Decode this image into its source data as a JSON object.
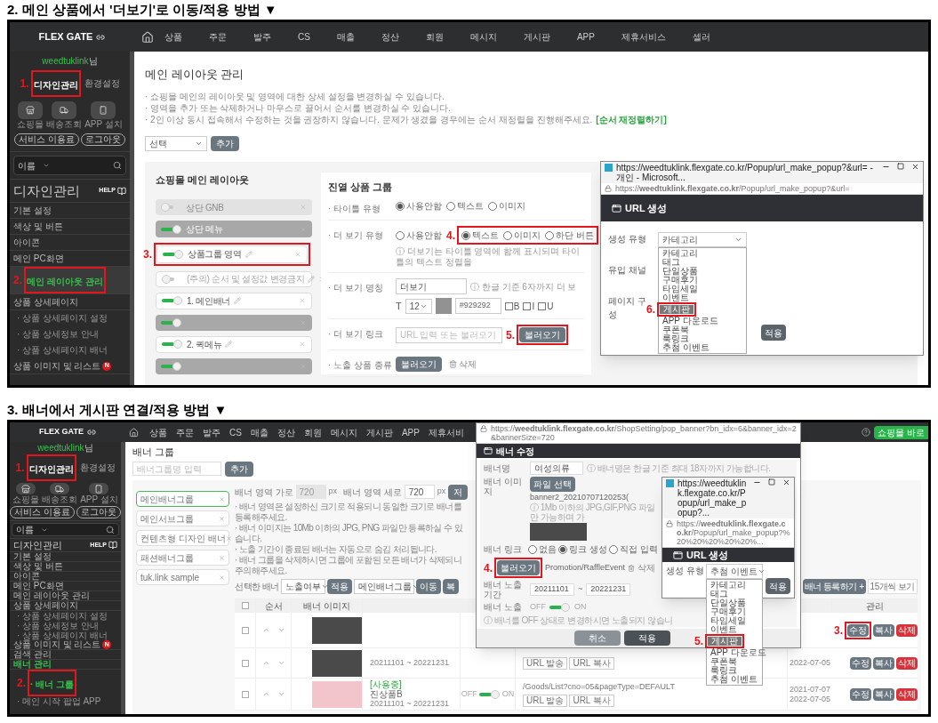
{
  "guide_1": {
    "heading": "2. 메인 상품에서 '더보기'로 이동/적용 방법 ▼",
    "topbar": {
      "logo": "FLEX GATE",
      "menu": [
        "상품",
        "주문",
        "발주",
        "CS",
        "매출",
        "정산",
        "회원",
        "메시지",
        "게시판",
        "APP",
        "제휴서비스",
        "셀러"
      ]
    },
    "sidebar": {
      "user": "weedtuklink",
      "user_suffix": "님",
      "tabs": [
        {
          "label": "디자인관리",
          "selected": true,
          "step": "1."
        },
        {
          "label": "환경설정",
          "selected": false
        }
      ],
      "shortcuts": [
        {
          "label": "쇼핑몰",
          "kind": "store"
        },
        {
          "label": "배송조회",
          "kind": "truck"
        },
        {
          "label": "APP 설치",
          "kind": "phone"
        }
      ],
      "buttons": [
        "서비스 이용료",
        "로그아웃"
      ],
      "search_select": "이름",
      "title": "디자인관리",
      "help": "HELP",
      "items": [
        {
          "label": "기본 설정",
          "kind": "item",
          "selected": false
        },
        {
          "label": "색상 및 버튼",
          "kind": "item",
          "selected": false
        },
        {
          "label": "아이콘",
          "kind": "item",
          "selected": false
        },
        {
          "label": "메인 PC화면",
          "kind": "item",
          "selected": false
        },
        {
          "label": "메인 레이아웃 관리",
          "kind": "item",
          "selected": true,
          "step": "2."
        },
        {
          "label": "상품 상세페이지",
          "kind": "item",
          "selected": false
        },
        {
          "label": "· 상품 상세페이지 설정",
          "kind": "sub",
          "selected": false
        },
        {
          "label": "· 상품 상세정보 안내",
          "kind": "sub",
          "selected": false
        },
        {
          "label": "· 상품 상세페이지 배너",
          "kind": "sub",
          "selected": false
        },
        {
          "label": "상품 이미지 및 리스트",
          "kind": "item",
          "selected": false,
          "badge": "N"
        }
      ]
    },
    "main": {
      "page_title": "메인 레이아웃 관리",
      "notes": [
        "· 쇼핑몰 메인의 레이아웃 및 영역에 대한 상세 설정을 변경하실 수 있습니다.",
        "· 영역을 추가 또는 삭제하거나 마우스로 끌어서 순서를 변경하실 수 있습니다.",
        "· 2인 이상 동시 접속해서 수정하는 것을 권장하지 않습니다. 문제가 생겼을 경우에는 순서 재정렬을 진행해주세요."
      ],
      "reorder_link": "[순서 재정렬하기]",
      "add_select": "선택",
      "add_button": "추가",
      "layout_panel": {
        "title": "쇼핑몰 메인 레이아웃",
        "items": [
          {
            "label": "상단 GNB",
            "kind": "fixed",
            "on": false,
            "editable": false
          },
          {
            "label": "상단 메뉴",
            "kind": "fixed",
            "on": true,
            "editable": false
          },
          {
            "label": "상품그룹 영역",
            "kind": "normal",
            "on": true,
            "editable": true,
            "step": "3."
          },
          {
            "label": "(주의) 순서 및 설정값 변경금지",
            "kind": "normal",
            "on": false,
            "editable": true
          },
          {
            "label": "1. 메인배너",
            "kind": "normal",
            "on": true,
            "editable": true
          },
          {
            "kind": "fixed",
            "on": true,
            "editable": false
          },
          {
            "label": "2. 퀵메뉴",
            "kind": "normal",
            "on": true,
            "editable": true
          },
          {
            "kind": "fixed",
            "on": true,
            "editable": false
          }
        ]
      },
      "settings_panel": {
        "title": "진열 상품 그룹",
        "rows": [
          {
            "label": "· 타이틀 유형",
            "kind": "radio",
            "options": [
              {
                "label": "사용안함",
                "selected": true,
                "highlighted": false
              },
              {
                "label": "텍스트",
                "selected": false,
                "highlighted": false
              },
              {
                "label": "이미지",
                "selected": false,
                "highlighted": false
              }
            ]
          },
          {
            "label": "· 더 보기 유형",
            "kind": "radio",
            "step": "4.",
            "options": [
              {
                "label": "사용안함",
                "selected": false,
                "highlighted": false
              },
              {
                "label": "텍스트",
                "selected": true,
                "highlighted": true
              },
              {
                "label": "이미지",
                "selected": false,
                "highlighted": true
              },
              {
                "label": "하단 버튼",
                "selected": false,
                "highlighted": true
              }
            ],
            "hint": "ⓘ 더보기는 타이틀 영역에 함께 표시되며 타이틀의 텍스트 정렬을"
          },
          {
            "label": "· 더 보기 명칭",
            "kind": "name",
            "value": "더보기",
            "hint": "ⓘ 한글 기준 6자까지 더 보",
            "style": {
              "prefix": "T",
              "size": "12",
              "color_value": "#929292",
              "checks": [
                {
                  "label": "B",
                  "checked": false
                },
                {
                  "label": "I",
                  "checked": false
                },
                {
                  "label": "U",
                  "checked": false
                }
              ]
            }
          },
          {
            "label": "· 더 보기 링크",
            "kind": "link",
            "placeholder": "URL 입력 또는 불러오기",
            "button": "불러오기",
            "step": "5."
          },
          {
            "label": "· 노출 상품 종류",
            "kind": "actions",
            "button": "불러오기",
            "delete": "삭제"
          }
        ]
      }
    },
    "popup": {
      "window_title": "https://weedtuklink.flexgate.co.kr/Popup/url_make_popup?&url= - 개인 - Microsoft...",
      "address": "https://**weedtuklink.flexgate.co.kr**/Popup/url_make_popup?&url=",
      "header": "URL 생성",
      "type_label": "생성 유형",
      "type_value": "카테고리",
      "options": [
        {
          "label": "카테고리",
          "selected": false
        },
        {
          "label": "태그",
          "selected": false
        },
        {
          "label": "단일상품",
          "selected": false
        },
        {
          "label": "구매후기",
          "selected": false
        },
        {
          "label": "타임세일",
          "selected": false
        },
        {
          "label": "이벤트",
          "selected": false
        },
        {
          "label": "게시판",
          "selected": true,
          "step": "6."
        },
        {
          "label": "APP 다운로드",
          "selected": false
        },
        {
          "label": "쿠폰북",
          "selected": false
        },
        {
          "label": "룩링크",
          "selected": false
        },
        {
          "label": "추첨 이벤트",
          "selected": false
        }
      ],
      "labels": [
        "유입 채널",
        "페이지 구성"
      ],
      "apply": "적용"
    }
  },
  "guide_2": {
    "heading": "3. 배너에서 게시판 연결/적용 방법 ▼",
    "topbar": {
      "logo": "FLEX GATE",
      "menu": [
        "상품",
        "주문",
        "발주",
        "CS",
        "매출",
        "정산",
        "회원",
        "메시지",
        "게시판",
        "APP",
        "제휴서비"
      ],
      "shop_button": "쇼핑몰 바로"
    },
    "sidebar": {
      "user": "weedtuklink",
      "user_suffix": "님",
      "tabs": [
        {
          "label": "디자인관리",
          "selected": true,
          "step": "1."
        },
        {
          "label": "환경설정",
          "selected": false
        }
      ],
      "shortcuts": [
        {
          "label": "쇼핑몰",
          "kind": "store"
        },
        {
          "label": "배송조회",
          "kind": "truck"
        },
        {
          "label": "APP 설치",
          "kind": "phone"
        }
      ],
      "buttons": [
        "서비스 이용료",
        "로그아웃"
      ],
      "search_select": "이름",
      "title": "디자인관리",
      "help": "HELP",
      "items": [
        {
          "label": "기본 설정",
          "kind": "item",
          "selected": false
        },
        {
          "label": "색상 및 버튼",
          "kind": "item",
          "selected": false
        },
        {
          "label": "아이콘",
          "kind": "item",
          "selected": false
        },
        {
          "label": "메인 PC화면",
          "kind": "item",
          "selected": false
        },
        {
          "label": "메인 레이아웃 관리",
          "kind": "item",
          "selected": false
        },
        {
          "label": "상품 상세페이지",
          "kind": "item",
          "selected": false
        },
        {
          "label": "· 상품 상세페이지 설정",
          "kind": "sub",
          "selected": false
        },
        {
          "label": "· 상품 상세정보 안내",
          "kind": "sub",
          "selected": false
        },
        {
          "label": "· 상품 상세페이지 배너",
          "kind": "sub",
          "selected": false
        },
        {
          "label": "상품 이미지 및 리스트",
          "kind": "item",
          "selected": false,
          "badge": "N"
        },
        {
          "label": "검색 관리",
          "kind": "item",
          "selected": false
        },
        {
          "label": "배너 관리",
          "kind": "item",
          "selected": true
        },
        {
          "label": "· 배너 그룹",
          "kind": "sub",
          "selected": true,
          "step": "2."
        },
        {
          "label": "· 메인 시작 팝업 APP",
          "kind": "sub",
          "selected": false
        }
      ]
    },
    "main": {
      "page_title": "배너 그룹",
      "group_placeholder": "배너그룹명 입력",
      "add_button": "추가",
      "groups": [
        {
          "label": "메인배너그룹",
          "selected": true
        },
        {
          "label": "메인서브그룹",
          "selected": false
        },
        {
          "label": "컨텐츠형 디자인 배너",
          "selected": false
        },
        {
          "label": "패션배너그룹",
          "selected": false
        },
        {
          "label": "tuk.link sample",
          "selected": false
        }
      ],
      "size": {
        "width_label": "배너 영역 가로",
        "width_value": "720",
        "width_unit": "px",
        "height_label": "배너 영역 세로",
        "height_value": "720",
        "height_unit": "px",
        "save": "저"
      },
      "notes": [
        "· 배너 영역은 설정하신 크기로 적용되니 동일한 크기로 배너를 등록해주세요.",
        "· 배너 이미지는 10Mb 이하의 JPG, PNG 파일만 등록하실 수 있습니다.",
        "· 노출 기간이 종료된 배너는 자동으로 숨김 처리됩니다.",
        "· 배너 그룹을 삭제하시면 그룹에 포함된 모든 배너가 삭제되니 주의해주세요."
      ],
      "bulk": {
        "label": "선택한 배너",
        "select_1": "노출여부",
        "apply": "적용",
        "select_2": "메인배너그룹",
        "move": "이동",
        "copy": "복"
      },
      "register": "배너 등록하기 +",
      "per_page": "15개씩 보기",
      "table": {
        "header_checked": false,
        "order_label": "순서",
        "image_label": "배너 이미지",
        "manage_label": "관리",
        "rows": [
          {
            "checked": false,
            "actions": [
              {
                "label": "수정",
                "kind": "edit",
                "step": "3."
              },
              {
                "label": "복사",
                "kind": "copy"
              },
              {
                "label": "삭제",
                "kind": "delete"
              }
            ]
          },
          {
            "checked": false,
            "period": "20211101 ~ 20221231",
            "url_buttons": [
              "URL 발송",
              "URL 복사"
            ],
            "dates": [
              "2022-07-05"
            ],
            "actions": [
              {
                "label": "수정",
                "kind": "edit"
              },
              {
                "label": "복사",
                "kind": "copy"
              },
              {
                "label": "삭제",
                "kind": "delete"
              }
            ]
          },
          {
            "checked": false,
            "status": "[사용중]",
            "name": "진상품B",
            "period": "20211101 ~ 20221231",
            "exposure": {
              "off": "OFF",
              "on": "ON",
              "state": true
            },
            "link": "/Goods/List?cno=05&pageType=DEFAULT",
            "url_buttons": [
              "URL 발송",
              "URL 복사"
            ],
            "dates": [
              "2021-07-07",
              "2022-07-05"
            ],
            "actions": [
              {
                "label": "수정",
                "kind": "edit"
              },
              {
                "label": "복사",
                "kind": "copy"
              },
              {
                "label": "삭제",
                "kind": "delete"
              }
            ]
          }
        ]
      }
    },
    "banner_popup": {
      "address": "https://**weedtuklink.flexgate.co.kr**/ShopSetting/pop_banner?bn_idx=6&banner_idx=2&bannerSize=720",
      "header": "배너 수정",
      "name_label": "배너명",
      "name_value": "여성의류",
      "name_hint": "ⓘ 배너명은 한글 기준 최대 18자까지 가능합니다.",
      "image_label": "배너 이미지",
      "file_button": "파일 선택",
      "file_name": "banner2_20210707120253(",
      "image_hint": "ⓘ 1Mb 이하의 JPG,GIF,PNG 파일만 가능하며 가",
      "link_label": "배너 링크",
      "link_options": [
        {
          "label": "없음",
          "selected": false
        },
        {
          "label": "링크 생성",
          "selected": true
        },
        {
          "label": "직접 입력",
          "selected": false
        }
      ],
      "load_button": "불러오기",
      "load_step": "4.",
      "link_value": "Promotion/RaffleEvent",
      "delete": "삭제",
      "period_label": "배너 노출 기간",
      "period_start": "20211101",
      "period_sep": "~",
      "period_end": "20221231",
      "exposure_label": "배너 노출",
      "exposure": {
        "off": "OFF",
        "on": "ON",
        "state": true
      },
      "exposure_hint": "ⓘ 배너를 OFF 상태로 변경하시면 노출되지 않습니",
      "cancel": "취소",
      "apply": "적용"
    },
    "popup": {
      "window_title": "https://weedtuklink.flexgate.co.kr/Popup/url_make_popup?...",
      "address": "https://**weedtuklink.flexgate.co.kr**/Popup/url_make_popup?%20%20%20%20%20%...",
      "header": "URL 생성",
      "type_label": "생성 유형",
      "type_value": "추첨 이벤트",
      "options": [
        {
          "label": "카테고리",
          "selected": false
        },
        {
          "label": "태그",
          "selected": false
        },
        {
          "label": "단일상품",
          "selected": false
        },
        {
          "label": "구매후기",
          "selected": false
        },
        {
          "label": "타임세일",
          "selected": false
        },
        {
          "label": "이벤트",
          "selected": false
        },
        {
          "label": "게시판",
          "selected": true,
          "step": "5."
        },
        {
          "label": "APP 다운로드",
          "selected": false
        },
        {
          "label": "쿠폰북",
          "selected": false
        },
        {
          "label": "룩링크",
          "selected": false
        },
        {
          "label": "추첨 이벤트",
          "selected": false
        }
      ],
      "apply": "적용"
    }
  }
}
